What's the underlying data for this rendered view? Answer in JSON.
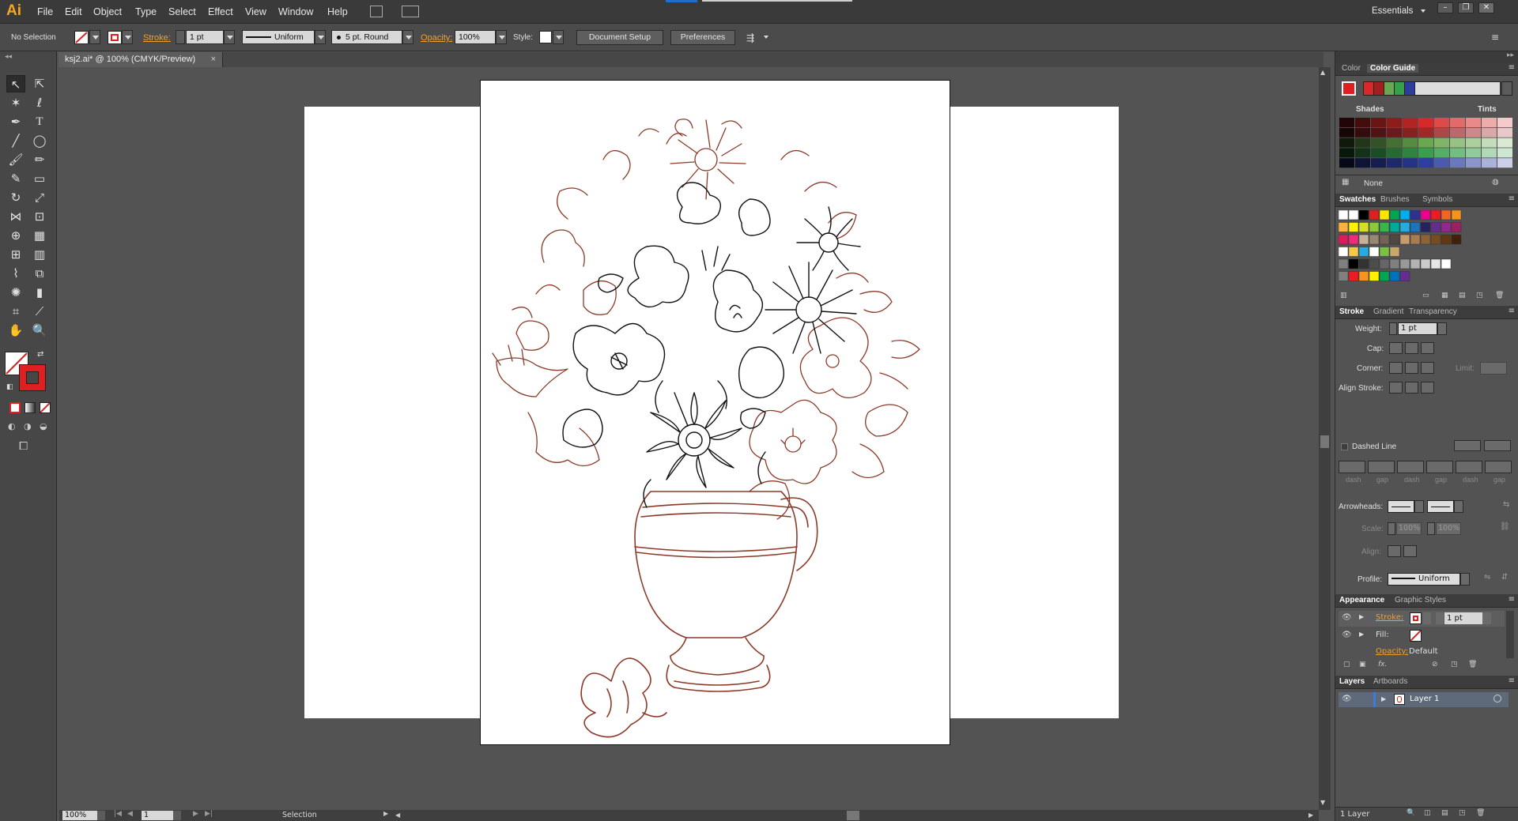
{
  "app": {
    "logo": "Ai",
    "workspace": "Essentials"
  },
  "menu": [
    "File",
    "Edit",
    "Object",
    "Type",
    "Select",
    "Effect",
    "View",
    "Window",
    "Help"
  ],
  "control": {
    "selection": "No Selection",
    "stroke_label": "Stroke:",
    "stroke_weight": "1 pt",
    "profile": "Uniform",
    "brush": "5 pt. Round",
    "opacity_label": "Opacity:",
    "opacity": "100%",
    "style_label": "Style:",
    "document_setup": "Document Setup",
    "preferences": "Preferences"
  },
  "document": {
    "tab": "ksj2.ai* @ 100% (CMYK/Preview)"
  },
  "status": {
    "zoom": "100%",
    "artboard": "1",
    "mode": "Selection"
  },
  "color_panel": {
    "tabs": [
      "Color",
      "Color Guide"
    ],
    "shades_label": "Shades",
    "tints_label": "Tints",
    "none_label": "None",
    "harmony": [
      "#d62a2a",
      "#a01f1f",
      "#6aa84f",
      "#38a04a",
      "#2d3ea0"
    ]
  },
  "swatches_panel": {
    "tabs": [
      "Swatches",
      "Brushes",
      "Symbols"
    ]
  },
  "stroke_panel": {
    "tabs": [
      "Stroke",
      "Gradient",
      "Transparency"
    ],
    "weight_label": "Weight:",
    "weight": "1 pt",
    "cap_label": "Cap:",
    "corner_label": "Corner:",
    "limit_label": "Limit:",
    "align_label": "Align Stroke:",
    "dashed_label": "Dashed Line",
    "dash_labels": [
      "dash",
      "gap",
      "dash",
      "gap",
      "dash",
      "gap"
    ],
    "arrowheads_label": "Arrowheads:",
    "scale_label": "Scale:",
    "scale_a": "100%",
    "scale_b": "100%",
    "align2_label": "Align:",
    "profile_label": "Profile:",
    "profile": "Uniform"
  },
  "appearance_panel": {
    "tabs": [
      "Appearance",
      "Graphic Styles"
    ],
    "stroke_label": "Stroke:",
    "stroke_weight": "1 pt",
    "fill_label": "Fill:",
    "opacity_label": "Opacity:",
    "opacity_value": "Default"
  },
  "layers_panel": {
    "tabs": [
      "Layers",
      "Artboards"
    ],
    "layer_name": "Layer 1",
    "count": "1 Layer"
  }
}
